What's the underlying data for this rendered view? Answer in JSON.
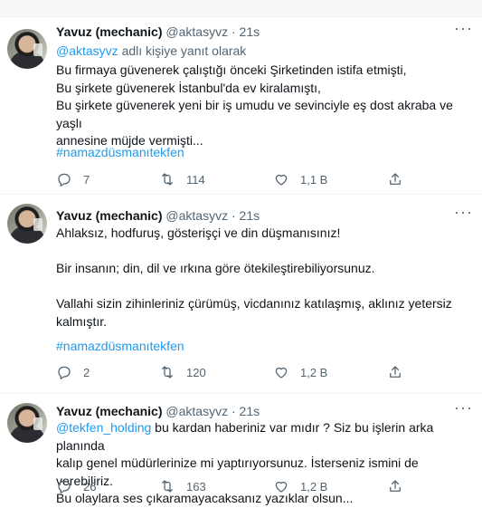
{
  "tweets": [
    {
      "name": "Yavuz (mechanic)",
      "handle": "@aktasyvz",
      "dot": "·",
      "time": "21s",
      "more": "···",
      "replying_handle": "@aktasyvz",
      "replying_text": " adlı kişiye yanıt olarak",
      "lines": [
        "Bu firmaya güvenerek çalıştığı önceki Şirketinden istifa etmişti,",
        "Bu şirkete güvenerek İstanbul'da ev kiralamıştı,",
        "Bu şirkete güvenerek yeni bir iş umudu ve sevinciyle eş dost akraba ve yaşlı",
        "annesine müjde vermişti..."
      ],
      "hashtag": "#namazdüsmanıtekfen",
      "replies": "7",
      "retweets": "114",
      "likes": "1,1 B"
    },
    {
      "name": "Yavuz (mechanic)",
      "handle": "@aktasyvz",
      "dot": "·",
      "time": "21s",
      "more": "···",
      "lines": [
        "Ahlaksız, hodfuruş, gösterişçi ve din düşmanısınız!",
        "",
        "Bir insanın; din, dil ve ırkına göre ötekileştirebiliyorsunuz.",
        "",
        "Vallahi sizin zihinleriniz çürümüş, vicdanınız katılaşmış, aklınız yetersiz",
        "kalmıştır."
      ],
      "hashtag": "#namazdüsmanıtekfen",
      "replies": "2",
      "retweets": "120",
      "likes": "1,2 B"
    },
    {
      "name": "Yavuz (mechanic)",
      "handle": "@aktasyvz",
      "dot": "·",
      "time": "21s",
      "more": "···",
      "first_mention": "@tekfen_holding",
      "first_rest": " bu kardan haberiniz var mıdır ? Siz bu işlerin arka planında",
      "lines": [
        "kalıp genel müdürlerinize mi yaptırıyorsunuz. İsterseniz ismini de verebiliriz.",
        "Bu olaylara ses çıkaramayacaksanız yazıklar olsun..."
      ],
      "replies": "26",
      "retweets": "163",
      "likes": "1,2 B"
    }
  ]
}
